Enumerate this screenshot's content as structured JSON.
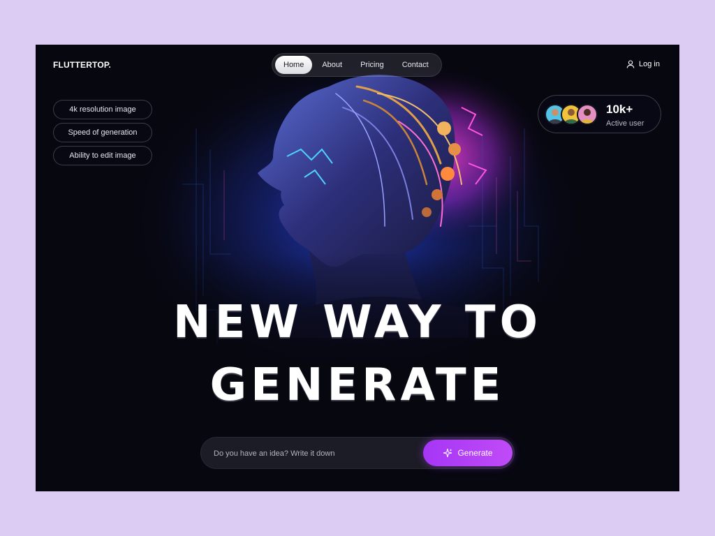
{
  "brand": {
    "logo": "FLUTTERTOP."
  },
  "nav": {
    "items": [
      {
        "label": "Home",
        "active": true
      },
      {
        "label": "About",
        "active": false
      },
      {
        "label": "Pricing",
        "active": false
      },
      {
        "label": "Contact",
        "active": false
      }
    ]
  },
  "auth": {
    "login_label": "Log in",
    "icon": "user-icon"
  },
  "features": [
    "4k resolution image",
    "Speed of generation",
    "Ability to edit image"
  ],
  "users": {
    "count": "10k+",
    "label": "Active user",
    "avatar_colors": [
      "#53c3e6",
      "#f2c33a",
      "#e48fc3"
    ]
  },
  "hero": {
    "headline_line1": "NEW WAY TO",
    "headline_line2": "GENERATE"
  },
  "prompt": {
    "placeholder": "Do you have an idea? Write it down",
    "value": "",
    "button_label": "Generate",
    "button_icon": "sparkle-icon"
  },
  "colors": {
    "page_bg": "#dccbf3",
    "frame_bg": "#070710",
    "accent": "#b040f6"
  }
}
